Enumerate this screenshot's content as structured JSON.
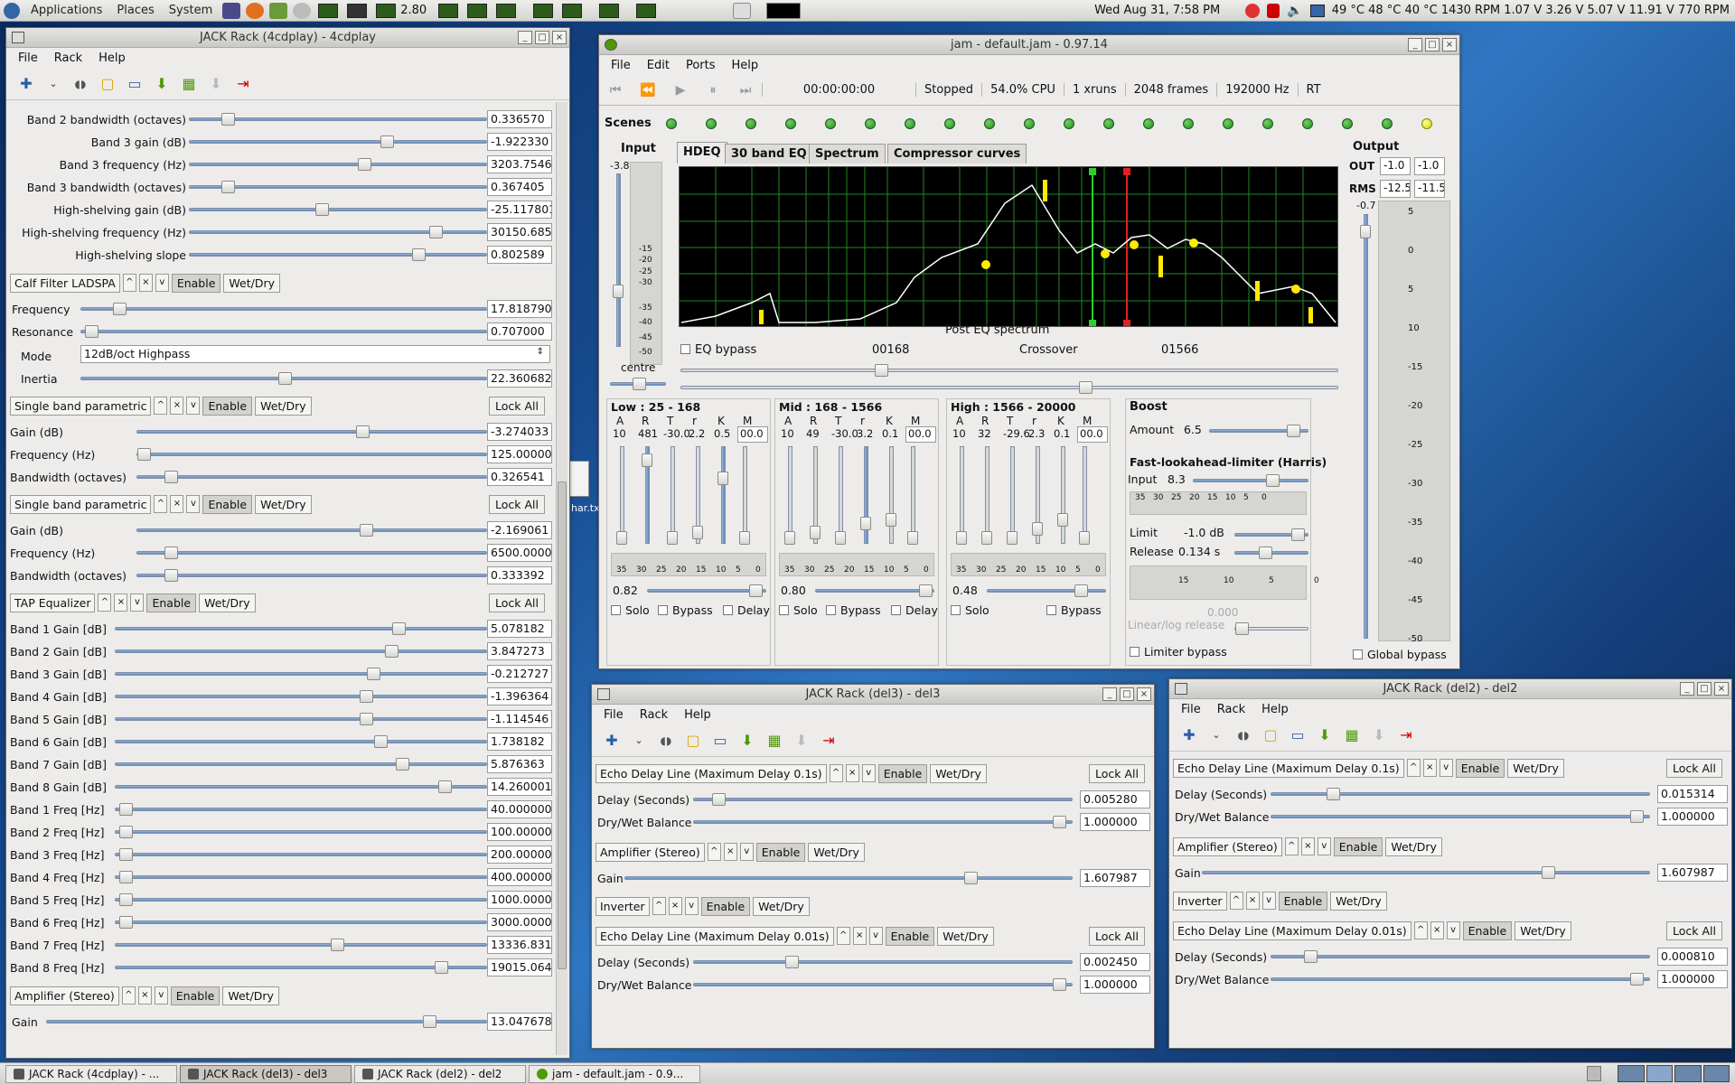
{
  "top_panel": {
    "menus": [
      "Applications",
      "Places",
      "System"
    ],
    "cpu_freq": "2.80",
    "clock": "Wed Aug 31,  7:58 PM",
    "sensors": "49 °C 48 °C 40 °C 1430 RPM 1.07 V 3.26 V 5.07 V 11.91 V  770 RPM"
  },
  "rack1": {
    "title": "JACK Rack (4cdplay) - 4cdplay",
    "menus": [
      "File",
      "Rack",
      "Help"
    ],
    "top_params": [
      {
        "label": "Band 2 bandwidth (octaves)",
        "value": "0.336570",
        "pos": 0.11
      },
      {
        "label": "Band 3 gain (dB)",
        "value": "-1.922330",
        "pos": 0.67
      },
      {
        "label": "Band 3 frequency (Hz)",
        "value": "3203.7546",
        "pos": 0.59
      },
      {
        "label": "Band 3 bandwidth (octaves)",
        "value": "0.367405",
        "pos": 0.11
      },
      {
        "label": "High-shelving gain (dB)",
        "value": "-25.117801",
        "pos": 0.44
      },
      {
        "label": "High-shelving frequency (Hz)",
        "value": "30150.685",
        "pos": 0.84
      },
      {
        "label": "High-shelving slope",
        "value": "0.802589",
        "pos": 0.78
      }
    ],
    "calf": {
      "name": "Calf Filter LADSPA",
      "params": [
        {
          "label": "Frequency",
          "value": "17.818790",
          "pos": 0.08
        },
        {
          "label": "Resonance",
          "value": "0.707000",
          "pos": 0.01
        }
      ],
      "mode_label": "Mode",
      "mode_value": "12dB/oct Highpass",
      "inertia_label": "Inertia",
      "inertia_value": "22.360682",
      "inertia_pos": 0.5
    },
    "sbp1": {
      "name": "Single band parametric",
      "params": [
        {
          "label": "Gain (dB)",
          "value": "-3.274033",
          "pos": 0.65
        },
        {
          "label": "Frequency (Hz)",
          "value": "125.000000",
          "pos": 0.0
        },
        {
          "label": "Bandwidth (octaves)",
          "value": "0.326541",
          "pos": 0.08
        }
      ]
    },
    "sbp2": {
      "name": "Single band parametric",
      "params": [
        {
          "label": "Gain (dB)",
          "value": "-2.169061",
          "pos": 0.66
        },
        {
          "label": "Frequency (Hz)",
          "value": "6500.000000",
          "pos": 0.08
        },
        {
          "label": "Bandwidth (octaves)",
          "value": "0.333392",
          "pos": 0.08
        }
      ]
    },
    "tap": {
      "name": "TAP Equalizer",
      "params": [
        {
          "label": "Band 1 Gain [dB]",
          "value": "5.078182",
          "pos": 0.77
        },
        {
          "label": "Band 2 Gain [dB]",
          "value": "3.847273",
          "pos": 0.75
        },
        {
          "label": "Band 3 Gain [dB]",
          "value": "-0.212727",
          "pos": 0.7
        },
        {
          "label": "Band 4 Gain [dB]",
          "value": "-1.396364",
          "pos": 0.68
        },
        {
          "label": "Band 5 Gain [dB]",
          "value": "-1.114546",
          "pos": 0.68
        },
        {
          "label": "Band 6 Gain [dB]",
          "value": "1.738182",
          "pos": 0.72
        },
        {
          "label": "Band 7 Gain [dB]",
          "value": "5.876363",
          "pos": 0.78
        },
        {
          "label": "Band 8 Gain [dB]",
          "value": "14.260001",
          "pos": 0.9
        },
        {
          "label": "Band 1 Freq [Hz]",
          "value": "40.000000",
          "pos": 0.01
        },
        {
          "label": "Band 2 Freq [Hz]",
          "value": "100.000000",
          "pos": 0.01
        },
        {
          "label": "Band 3 Freq [Hz]",
          "value": "200.000000",
          "pos": 0.01
        },
        {
          "label": "Band 4 Freq [Hz]",
          "value": "400.000000",
          "pos": 0.01
        },
        {
          "label": "Band 5 Freq [Hz]",
          "value": "1000.000000",
          "pos": 0.01
        },
        {
          "label": "Band 6 Freq [Hz]",
          "value": "3000.000000",
          "pos": 0.01
        },
        {
          "label": "Band 7 Freq [Hz]",
          "value": "13336.831",
          "pos": 0.6
        },
        {
          "label": "Band 8 Freq [Hz]",
          "value": "19015.064",
          "pos": 0.89
        }
      ]
    },
    "amp": {
      "name": "Amplifier (Stereo)",
      "params": [
        {
          "label": "Gain",
          "value": "13.047678",
          "pos": 0.88
        }
      ]
    }
  },
  "common": {
    "enable": "Enable",
    "wetdry": "Wet/Dry",
    "lockall": "Lock All",
    "up": "^",
    "close": "×",
    "down": "v"
  },
  "jam": {
    "title": "jam - default.jam - 0.97.14",
    "menus": [
      "File",
      "Edit",
      "Ports",
      "Help"
    ],
    "time": "00:00:00:00",
    "status": "Stopped",
    "cpu": "54.0% CPU",
    "xruns": "1 xruns",
    "frames": "2048 frames",
    "rate": "192000 Hz",
    "rt": "RT",
    "scenes_label": "Scenes",
    "input_label": "Input",
    "input_value": "-3.8",
    "centre": "centre",
    "output_label": "Output",
    "out_label": "OUT",
    "out_l": "-1.0",
    "out_r": "-1.0",
    "rms_label": "RMS",
    "rms_l": "-12.5",
    "rms_r": "-11.5",
    "out_gain": "-0.7",
    "tabs": [
      "HDEQ",
      "30 band EQ",
      "Spectrum",
      "Compressor curves"
    ],
    "graph_caption": "Post EQ spectrum",
    "eq_bypass": "EQ bypass",
    "xover1": "00168",
    "crossover": "Crossover",
    "xover2": "01566",
    "bands": [
      {
        "title": "Low : 25 - 168",
        "heads": [
          "A",
          "R",
          "T",
          "r",
          "K",
          "M"
        ],
        "vals": [
          "10",
          "481",
          "-30.0",
          "2.2",
          "0.5"
        ],
        "m": "00.0",
        "gain": "0.82",
        "solo": "Solo",
        "bypass": "Bypass",
        "delay": "Delay"
      },
      {
        "title": "Mid : 168 - 1566",
        "heads": [
          "A",
          "R",
          "T",
          "r",
          "K",
          "M"
        ],
        "vals": [
          "10",
          "49",
          "-30.0",
          "3.2",
          "0.1"
        ],
        "m": "00.0",
        "gain": "0.80",
        "solo": "Solo",
        "bypass": "Bypass",
        "delay": "Delay"
      },
      {
        "title": "High : 1566 - 20000",
        "heads": [
          "A",
          "R",
          "T",
          "r",
          "K",
          "M"
        ],
        "vals": [
          "10",
          "32",
          "-29.6",
          "2.3",
          "0.1"
        ],
        "m": "00.0",
        "gain": "0.48",
        "solo": "Solo",
        "bypass": "Bypass",
        "delay": ""
      }
    ],
    "meter_scale": [
      "35",
      "30",
      "25",
      "20",
      "15",
      "10",
      "5",
      "0"
    ],
    "boost_label": "Boost",
    "amount_label": "Amount",
    "amount_value": "6.5",
    "limiter_title": "Fast-lookahead-limiter (Harris)",
    "lim_input_label": "Input",
    "lim_input_value": "8.3",
    "limit_label": "Limit",
    "limit_value": "-1.0 dB",
    "release_label": "Release",
    "release_value": "0.134 s",
    "rel_scale": [
      "15",
      "10",
      "5",
      "0"
    ],
    "linlog_label": "Linear/log release",
    "linlog_value": "0.000",
    "limiter_bypass": "Limiter bypass",
    "global_bypass": "Global bypass",
    "scale_left": [
      "-15",
      "-20",
      "-25",
      "-30",
      "-35",
      "-40",
      "-45",
      "-50"
    ],
    "scale_out": [
      "5",
      "0",
      "5",
      "10",
      "-15",
      "-20",
      "-25",
      "-30",
      "-35",
      "-40",
      "-45",
      "-50"
    ]
  },
  "rack_del3": {
    "title": "JACK Rack (del3) - del3",
    "menus": [
      "File",
      "Rack",
      "Help"
    ],
    "echo1": {
      "name": "Echo Delay Line (Maximum Delay 0.1s)",
      "params": [
        {
          "label": "Delay (Seconds)",
          "value": "0.005280",
          "pos": 0.05
        },
        {
          "label": "Dry/Wet Balance",
          "value": "1.000000",
          "pos": 0.98
        }
      ]
    },
    "amp": {
      "name": "Amplifier (Stereo)",
      "params": [
        {
          "label": "Gain",
          "value": "1.607987",
          "pos": 0.78
        }
      ]
    },
    "inv": {
      "name": "Inverter"
    },
    "echo2": {
      "name": "Echo Delay Line (Maximum Delay 0.01s)",
      "params": [
        {
          "label": "Delay (Seconds)",
          "value": "0.002450",
          "pos": 0.25
        },
        {
          "label": "Dry/Wet Balance",
          "value": "1.000000",
          "pos": 0.98
        }
      ]
    }
  },
  "rack_del2": {
    "title": "JACK Rack (del2) - del2",
    "menus": [
      "File",
      "Rack",
      "Help"
    ],
    "echo1": {
      "name": "Echo Delay Line (Maximum Delay 0.1s)",
      "params": [
        {
          "label": "Delay (Seconds)",
          "value": "0.015314",
          "pos": 0.15
        },
        {
          "label": "Dry/Wet Balance",
          "value": "1.000000",
          "pos": 0.98
        }
      ]
    },
    "amp": {
      "name": "Amplifier (Stereo)",
      "params": [
        {
          "label": "Gain",
          "value": "1.607987",
          "pos": 0.78
        }
      ]
    },
    "inv": {
      "name": "Inverter"
    },
    "echo2": {
      "name": "Echo Delay Line (Maximum Delay 0.01s)",
      "params": [
        {
          "label": "Delay (Seconds)",
          "value": "0.000810",
          "pos": 0.09
        },
        {
          "label": "Dry/Wet Balance",
          "value": "1.000000",
          "pos": 0.98
        }
      ]
    }
  },
  "taskbar": [
    {
      "label": "JACK Rack (4cdplay) - ...",
      "active": false
    },
    {
      "label": "JACK Rack (del3) - del3",
      "active": true
    },
    {
      "label": "JACK Rack (del2) - del2",
      "active": false
    },
    {
      "label": "jam - default.jam - 0.9...",
      "active": false
    }
  ],
  "desktop_file_label": "har.tx"
}
